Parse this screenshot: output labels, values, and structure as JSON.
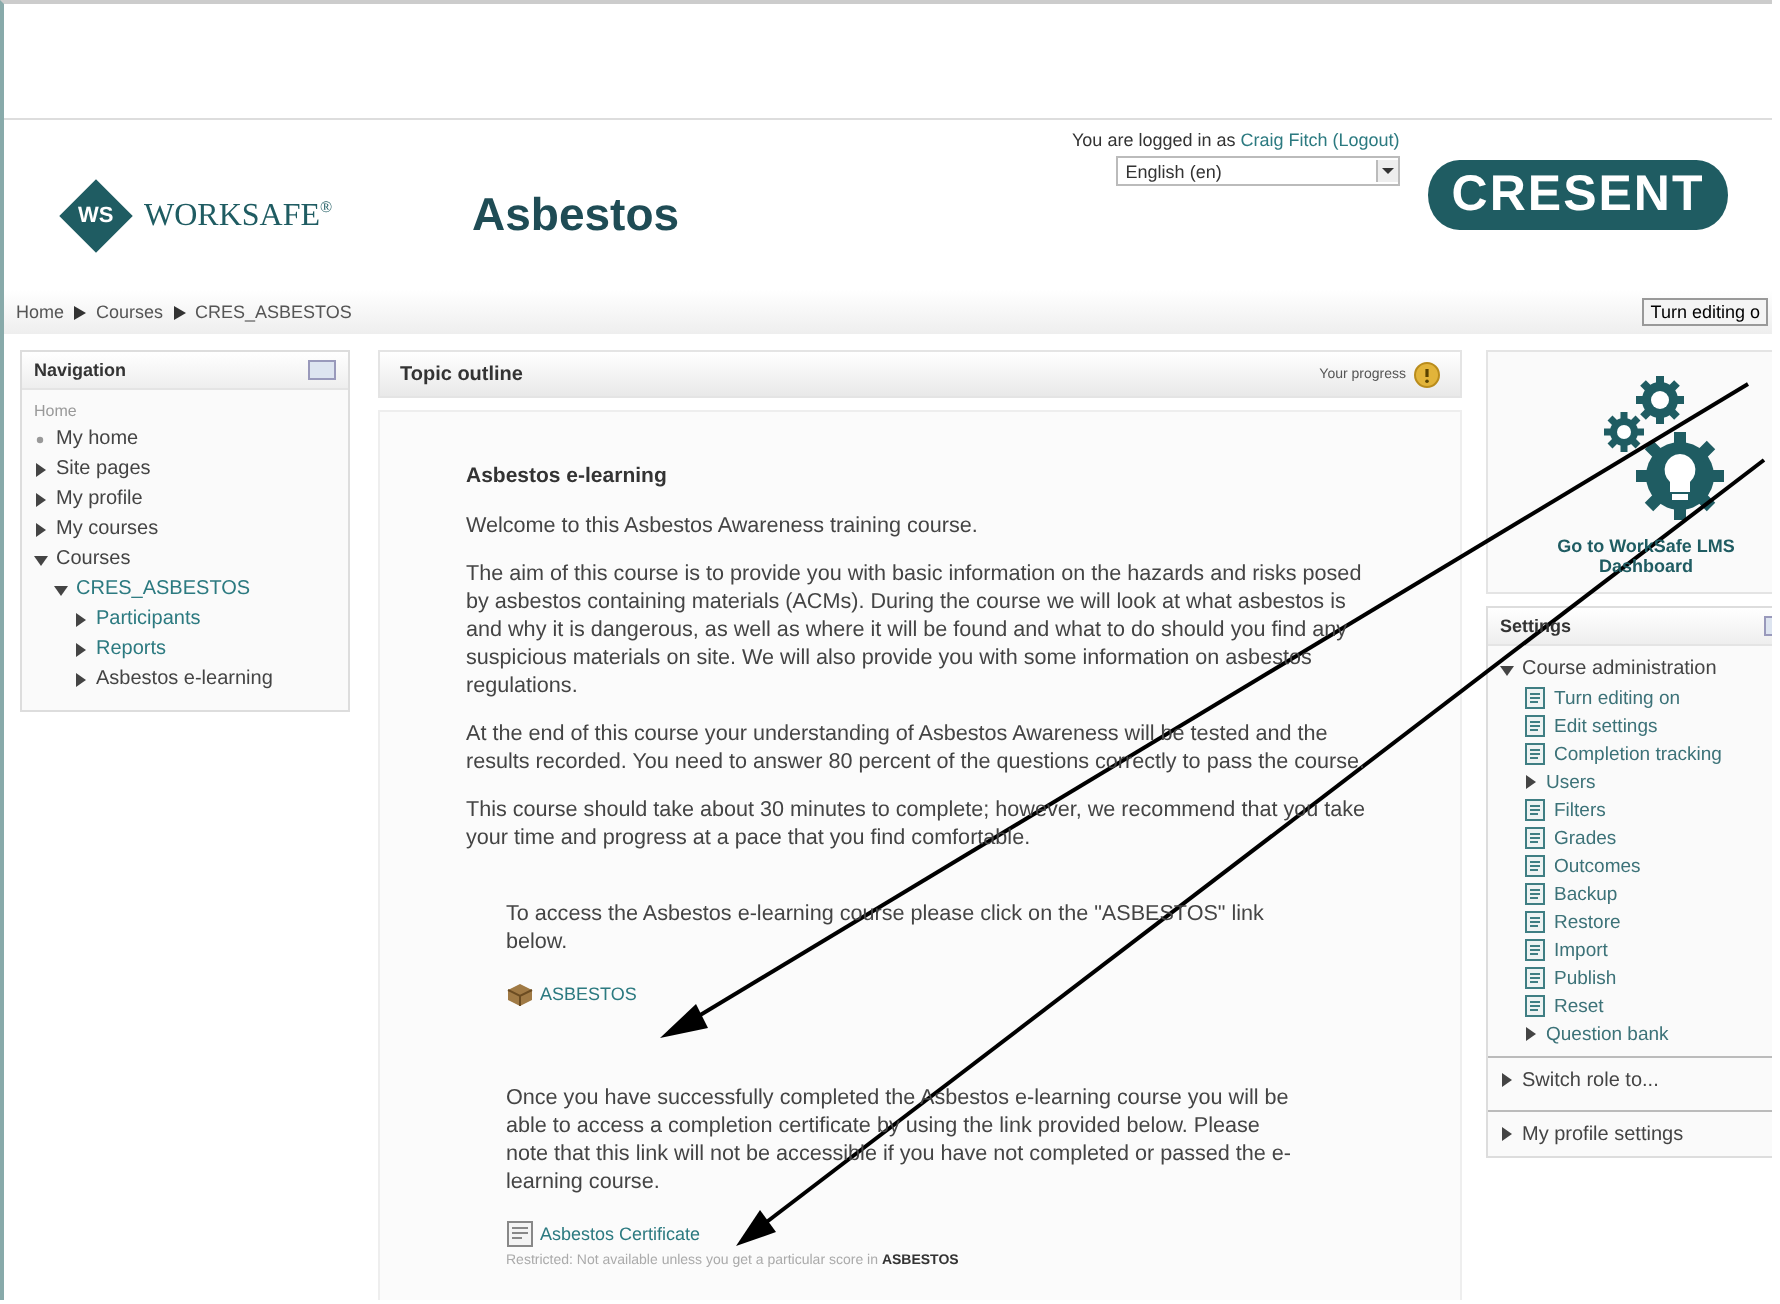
{
  "header": {
    "logo_mark": "WS",
    "logo_text": "WORKSAFE",
    "logo_sup": "®",
    "title": "Asbestos",
    "login": {
      "prefix": "You are logged in as",
      "user": "Craig Fitch",
      "logout": "(Logout)"
    },
    "language": "English (en)",
    "company_logo": "CRESENT"
  },
  "breadcrumb": [
    "Home",
    "Courses",
    "CRES_ASBESTOS"
  ],
  "edit_button": "Turn editing o",
  "navigation": {
    "title": "Navigation",
    "root": "Home",
    "items": [
      {
        "label": "My home",
        "kind": "leaf",
        "link": false
      },
      {
        "label": "Site pages",
        "kind": "branch",
        "expanded": false,
        "link": false
      },
      {
        "label": "My profile",
        "kind": "branch",
        "expanded": false,
        "link": false
      },
      {
        "label": "My courses",
        "kind": "branch",
        "expanded": false,
        "link": false
      },
      {
        "label": "Courses",
        "kind": "branch",
        "expanded": true,
        "link": false,
        "children": [
          {
            "label": "CRES_ASBESTOS",
            "kind": "branch",
            "expanded": true,
            "link": true,
            "children": [
              {
                "label": "Participants",
                "kind": "branch",
                "expanded": false,
                "link": true
              },
              {
                "label": "Reports",
                "kind": "branch",
                "expanded": false,
                "link": true
              },
              {
                "label": "Asbestos e-learning",
                "kind": "branch",
                "expanded": false,
                "link": false
              }
            ]
          }
        ]
      }
    ]
  },
  "topic": {
    "title": "Topic outline",
    "progress_label": "Your progress",
    "section_title": "Asbestos e-learning",
    "paragraphs": [
      "Welcome to this Asbestos Awareness training course.",
      "The aim of this course is to provide you with basic information on the hazards and risks posed by asbestos containing materials (ACMs). During the course we will look at what asbestos is and why it is dangerous, as well as where it will be found and what to do should you find any suspicious materials on site. We will also provide you with some information on asbestos regulations.",
      "At the end of this course your understanding of Asbestos Awareness will be tested and the results recorded. You need to answer 80 percent of the questions correctly to pass the course.",
      "This course should take about 30 minutes to complete; however, we recommend that you take your time and progress at a pace that you find comfortable."
    ],
    "activities": [
      {
        "intro": "To access the Asbestos e-learning course please click on the \"ASBESTOS\" link below.",
        "kind": "package",
        "link": "ASBESTOS"
      },
      {
        "intro": "Once you have successfully completed the Asbestos e-learning course you will be able to access a completion certificate by using the link provided below. Please note that this link will not be accessible if you have not completed or passed the e-learning course.",
        "kind": "certificate",
        "link": "Asbestos Certificate",
        "restriction": "Restricted: Not available unless you get a particular score in **ASBESTOS**"
      }
    ]
  },
  "dashboard_link": "Go to WorkSafe LMS Dashboard",
  "settings": {
    "title": "Settings",
    "group": "Course administration",
    "items": [
      {
        "label": "Turn editing on",
        "kind": "link"
      },
      {
        "label": "Edit settings",
        "kind": "link"
      },
      {
        "label": "Completion tracking",
        "kind": "link"
      },
      {
        "label": "Users",
        "kind": "branch"
      },
      {
        "label": "Filters",
        "kind": "link"
      },
      {
        "label": "Grades",
        "kind": "link"
      },
      {
        "label": "Outcomes",
        "kind": "link"
      },
      {
        "label": "Backup",
        "kind": "link"
      },
      {
        "label": "Restore",
        "kind": "link"
      },
      {
        "label": "Import",
        "kind": "link"
      },
      {
        "label": "Publish",
        "kind": "link"
      },
      {
        "label": "Reset",
        "kind": "link"
      },
      {
        "label": "Question bank",
        "kind": "branch"
      }
    ],
    "more": [
      "Switch role to...",
      "My profile settings"
    ]
  }
}
